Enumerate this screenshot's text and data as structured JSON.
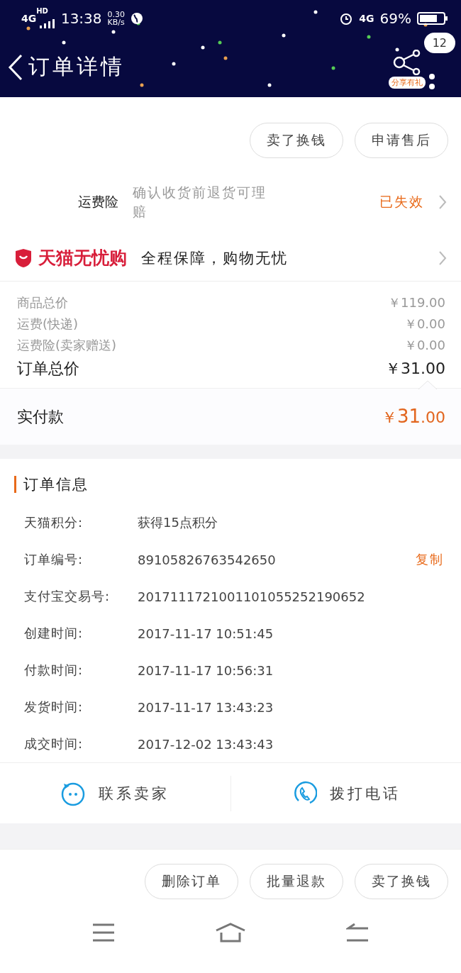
{
  "status_bar": {
    "network_left": "4G",
    "network_hd": "HD",
    "time": "13:38",
    "speed_value": "0.30",
    "speed_unit": "KB/s",
    "network_right": "4G",
    "battery_text": "69%"
  },
  "header": {
    "title": "订单详情",
    "share_label": "分享有礼",
    "badge": "12"
  },
  "top_actions": [
    "卖了换钱",
    "申请售后"
  ],
  "insurance": {
    "label": "运费险",
    "description": "确认收货前退货可理赔",
    "status": "已失效"
  },
  "tmall_guarantee": {
    "brand": "天猫无忧购",
    "slogan": "全程保障，购物无忧"
  },
  "price_lines": [
    {
      "label": "商品总价",
      "value": "￥119.00"
    },
    {
      "label": "运费(快递)",
      "value": "￥0.00"
    },
    {
      "label": "运费险(卖家赠送)",
      "value": "￥0.00"
    }
  ],
  "order_total": {
    "label": "订单总价",
    "value": "￥31.00"
  },
  "paid": {
    "label": "实付款",
    "currency": "￥",
    "integer": "31",
    "decimal": ".00"
  },
  "order_info": {
    "title": "订单信息",
    "rows": [
      {
        "label": "天猫积分:",
        "value": "获得15点积分"
      },
      {
        "label": "订单编号:",
        "value": "89105826763542650",
        "action": "复制"
      },
      {
        "label": "支付宝交易号:",
        "value": "2017111721001101055252190652"
      },
      {
        "label": "创建时间:",
        "value": "2017-11-17 10:51:45"
      },
      {
        "label": "付款时间:",
        "value": "2017-11-17 10:56:31"
      },
      {
        "label": "发货时间:",
        "value": "2017-11-17 13:43:23"
      },
      {
        "label": "成交时间:",
        "value": "2017-12-02 13:43:43"
      }
    ]
  },
  "contact": [
    {
      "kind": "chat",
      "label": "联系卖家"
    },
    {
      "kind": "phone",
      "label": "拨打电话"
    }
  ],
  "bottom_actions": [
    "删除订单",
    "批量退款",
    "卖了换钱"
  ]
}
